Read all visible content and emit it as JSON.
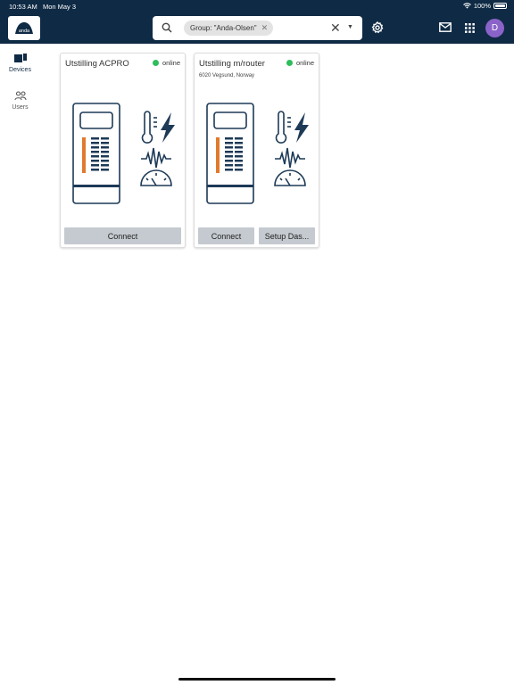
{
  "status_bar": {
    "time": "10:53 AM",
    "date": "Mon May 3",
    "battery": "100%"
  },
  "header": {
    "logo_text": "anda",
    "search": {
      "chip_label": "Group: \"Anda-Olsen\"",
      "chip_remove": "✕",
      "clear": "✕",
      "dropdown": "▼"
    },
    "avatar_initial": "D"
  },
  "nav": {
    "items": [
      {
        "label": "Devices",
        "icon": "devices-icon"
      },
      {
        "label": "Users",
        "icon": "users-icon"
      }
    ]
  },
  "devices": [
    {
      "name": "Utstilling ACPRO",
      "status": "online",
      "location": "",
      "buttons": [
        "Connect"
      ]
    },
    {
      "name": "Utstilling m/router",
      "status": "online",
      "location": "6020 Vegsund, Norway",
      "buttons": [
        "Connect",
        "Setup Das..."
      ]
    }
  ],
  "colors": {
    "header": "#0f2a44",
    "online": "#2ebd5b",
    "accent_orange": "#e07a2e",
    "avatar": "#8a63c9"
  }
}
